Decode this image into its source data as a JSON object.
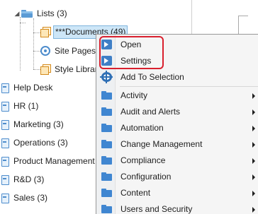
{
  "tree": {
    "lists": "Lists (3)",
    "documents": "***Documents (49)",
    "site_pages": "Site Pages",
    "style_library": "Style Library",
    "sites": [
      "Help Desk",
      "HR (1)",
      "Marketing (3)",
      "Operations (3)",
      "Product Management",
      "R&D (3)",
      "Sales (3)"
    ]
  },
  "menu": {
    "items": [
      {
        "label": "Open",
        "icon": "command-icon",
        "submenu": false
      },
      {
        "label": "Settings",
        "icon": "command-icon",
        "submenu": false
      },
      {
        "label": "Add To Selection",
        "icon": "gear-icon",
        "submenu": false
      },
      {
        "label": "Activity",
        "icon": "folder-icon",
        "submenu": true
      },
      {
        "label": "Audit and Alerts",
        "icon": "folder-icon",
        "submenu": true
      },
      {
        "label": "Automation",
        "icon": "folder-icon",
        "submenu": true
      },
      {
        "label": "Change Management",
        "icon": "folder-icon",
        "submenu": true
      },
      {
        "label": "Compliance",
        "icon": "folder-icon",
        "submenu": true
      },
      {
        "label": "Configuration",
        "icon": "folder-icon",
        "submenu": true
      },
      {
        "label": "Content",
        "icon": "folder-icon",
        "submenu": true
      },
      {
        "label": "Users and Security",
        "icon": "folder-icon",
        "submenu": true
      }
    ]
  },
  "colors": {
    "selection_bg": "#cde6f7",
    "highlight_ring": "#d9202e",
    "icon_blue": "#3f86d1"
  }
}
